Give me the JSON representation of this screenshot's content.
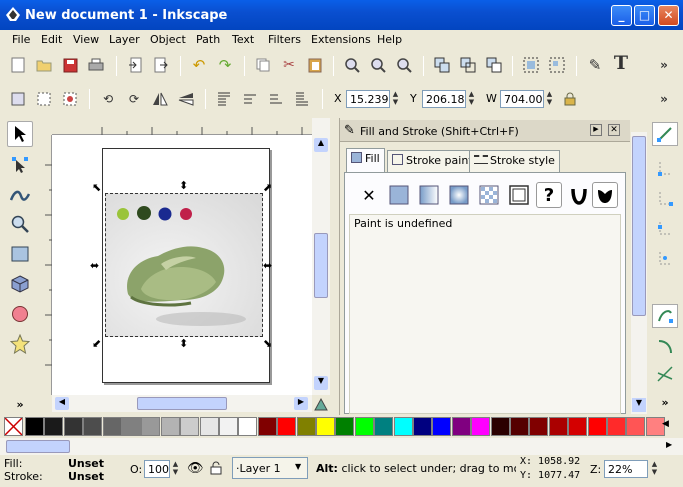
{
  "window": {
    "title": "New document 1 - Inkscape",
    "controls": [
      "_",
      "□",
      "✕"
    ]
  },
  "menu": [
    "File",
    "Edit",
    "View",
    "Layer",
    "Object",
    "Path",
    "Text",
    "Filters",
    "Extensions",
    "Help"
  ],
  "toolbar_more": "»",
  "toolctrl": {
    "x_label": "X",
    "x_value": "15.239",
    "y_label": "Y",
    "y_value": "206.181",
    "w_label": "W",
    "w_value": "704.000",
    "more": "»"
  },
  "panel": {
    "title": "Fill and Stroke (Shift+Ctrl+F)",
    "tabs": [
      "Fill",
      "Stroke paint",
      "Stroke style"
    ],
    "paint_message": "Paint is undefined",
    "unset_glyph": "✕",
    "unknown_glyph": "?"
  },
  "toolbox_more": "»",
  "dots": {
    "colors": [
      "#9ac43a",
      "#2f4a1f",
      "#1a2a90",
      "#c0204a"
    ]
  },
  "palette": {
    "colors": [
      "#000000",
      "#1a1a1a",
      "#333333",
      "#4d4d4d",
      "#666666",
      "#808080",
      "#999999",
      "#b3b3b3",
      "#cccccc",
      "#e6e6e6",
      "#f2f2f2",
      "#ffffff",
      "#800000",
      "#ff0000",
      "#808000",
      "#ffff00",
      "#008000",
      "#00ff00",
      "#008080",
      "#00ffff",
      "#000080",
      "#0000ff",
      "#800080",
      "#ff00ff",
      "#2b0000",
      "#550000",
      "#800000",
      "#aa0000",
      "#d40000",
      "#ff0000",
      "#ff2a2a",
      "#ff5555",
      "#ff8080"
    ]
  },
  "status": {
    "fill_label": "Fill:",
    "fill_value": "Unset",
    "stroke_label": "Stroke:",
    "stroke_value": "Unset",
    "opacity_label": "O:",
    "opacity_value": "100",
    "layer": "·Layer 1",
    "message_bold": "Alt:",
    "message": " click to select under; drag to move se",
    "x_coord": "X: 1058.92",
    "y_coord": "Y: 1077.47",
    "zoom_label": "Z:",
    "zoom_value": "22%"
  }
}
